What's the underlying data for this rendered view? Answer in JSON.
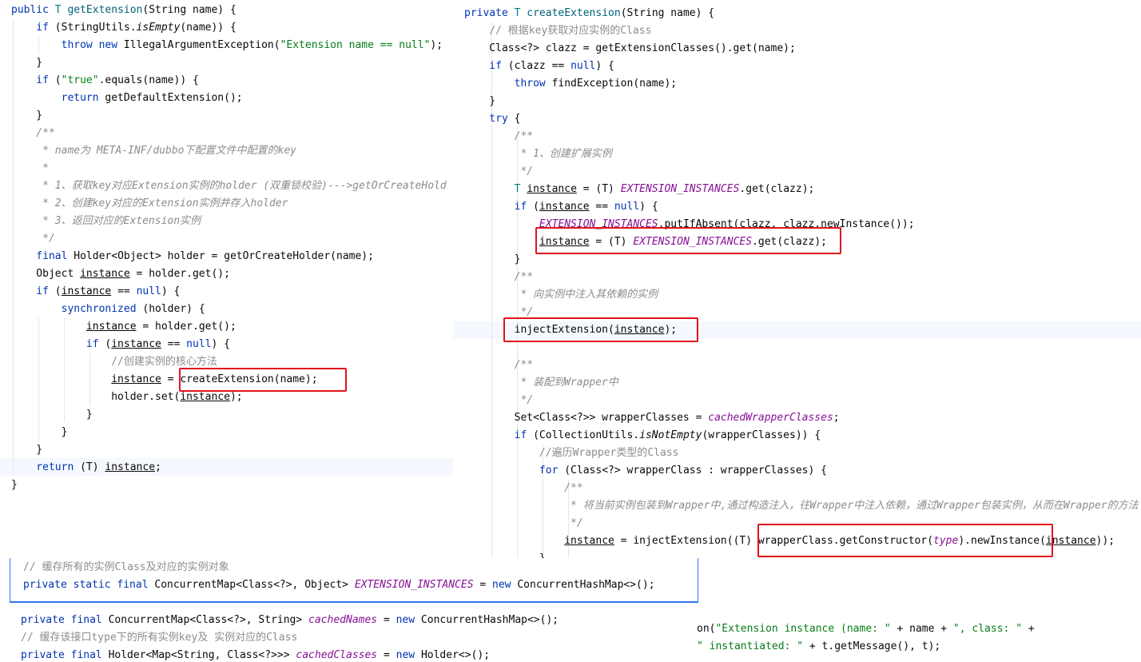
{
  "colors": {
    "keyword": "#0033b3",
    "string": "#067d17",
    "comment": "#8c8c8c",
    "field": "#871094",
    "method": "#00627a",
    "highlight_box": "#e0141b",
    "selection_border": "#3574f0"
  },
  "left": {
    "lines": [
      [
        [
          "public ",
          "kw"
        ],
        [
          "T ",
          "tp"
        ],
        [
          "getExtension",
          "fn"
        ],
        [
          "(String name) {",
          ""
        ]
      ],
      [
        [
          "    if ",
          "kw"
        ],
        [
          "(StringUtils.",
          ""
        ],
        [
          "isEmpty",
          "ital"
        ],
        [
          "(name)) {",
          ""
        ]
      ],
      [
        [
          "        throw new ",
          "kw"
        ],
        [
          "IllegalArgumentException(",
          ""
        ],
        [
          "\"Extension name == null\"",
          "str"
        ],
        [
          ");",
          ""
        ]
      ],
      [
        [
          "    }",
          ""
        ]
      ],
      [
        [
          "    if ",
          "kw"
        ],
        [
          "(",
          ""
        ],
        [
          "\"true\"",
          "str"
        ],
        [
          ".equals(name)) {",
          ""
        ]
      ],
      [
        [
          "        return ",
          "kw"
        ],
        [
          "getDefaultExtension();",
          ""
        ]
      ],
      [
        [
          "    }",
          ""
        ]
      ],
      [
        [
          "    /**",
          "doc"
        ]
      ],
      [
        [
          "     * name为 META-INF/dubbo下配置文件中配置的key",
          "doc"
        ]
      ],
      [
        [
          "     *",
          "doc"
        ]
      ],
      [
        [
          "     * 1、获取key对应Extension实例的holder (双重锁校验)--->getOrCreateHold",
          "doc"
        ]
      ],
      [
        [
          "     * 2、创建key对应的Extension实例并存入holder",
          "doc"
        ]
      ],
      [
        [
          "     * 3、返回对应的Extension实例",
          "doc"
        ]
      ],
      [
        [
          "     */",
          "doc"
        ]
      ],
      [
        [
          "    final ",
          "kw"
        ],
        [
          "Holder<Object> holder = getOrCreateHolder(name);",
          ""
        ]
      ],
      [
        [
          "    Object ",
          ""
        ],
        [
          "instance",
          "u"
        ],
        [
          " = holder.get();",
          ""
        ]
      ],
      [
        [
          "    if ",
          "kw"
        ],
        [
          "(",
          ""
        ],
        [
          "instance",
          "u"
        ],
        [
          " == ",
          ""
        ],
        [
          "null",
          "kw"
        ],
        [
          ") {",
          ""
        ]
      ],
      [
        [
          "        synchronized ",
          "kw"
        ],
        [
          "(holder) {",
          ""
        ]
      ],
      [
        [
          "            ",
          ""
        ],
        [
          "instance",
          "u"
        ],
        [
          " = holder.get();",
          ""
        ]
      ],
      [
        [
          "            if ",
          "kw"
        ],
        [
          "(",
          ""
        ],
        [
          "instance",
          "u"
        ],
        [
          " == ",
          ""
        ],
        [
          "null",
          "kw"
        ],
        [
          ") {",
          ""
        ]
      ],
      [
        [
          "                //创建实例的核心方法",
          "cmt"
        ]
      ],
      [
        [
          "                ",
          ""
        ],
        [
          "instance",
          "u"
        ],
        [
          " = createExtension(name);",
          ""
        ]
      ],
      [
        [
          "                holder.set(",
          ""
        ],
        [
          "instance",
          "u"
        ],
        [
          ");",
          ""
        ]
      ],
      [
        [
          "            }",
          ""
        ]
      ],
      [
        [
          "        }",
          ""
        ]
      ],
      [
        [
          "    }",
          ""
        ]
      ],
      [
        [
          "    return ",
          "kw"
        ],
        [
          "(T) ",
          ""
        ],
        [
          "instance",
          "u"
        ],
        [
          ";",
          ""
        ]
      ],
      [
        [
          "}",
          ""
        ]
      ]
    ]
  },
  "right": {
    "lines": [
      [
        [
          "private ",
          "kw"
        ],
        [
          "T ",
          "tp"
        ],
        [
          "createExtension",
          "fn"
        ],
        [
          "(String name) {",
          ""
        ]
      ],
      [
        [
          "    // 根据key获取对应实例的Class",
          "cmt"
        ]
      ],
      [
        [
          "    Class<?> clazz = getExtensionClasses().get(name);",
          ""
        ]
      ],
      [
        [
          "    if ",
          "kw"
        ],
        [
          "(clazz == ",
          ""
        ],
        [
          "null",
          "kw"
        ],
        [
          ") {",
          ""
        ]
      ],
      [
        [
          "        throw ",
          "kw"
        ],
        [
          "findException(name);",
          ""
        ]
      ],
      [
        [
          "    }",
          ""
        ]
      ],
      [
        [
          "    try ",
          "kw"
        ],
        [
          "{",
          ""
        ]
      ],
      [
        [
          "        /**",
          "doc"
        ]
      ],
      [
        [
          "         * 1、创建扩展实例",
          "doc"
        ]
      ],
      [
        [
          "         */",
          "doc"
        ]
      ],
      [
        [
          "        ",
          ""
        ],
        [
          "T ",
          "tp"
        ],
        [
          "instance",
          "u"
        ],
        [
          " = (T) ",
          ""
        ],
        [
          "EXTENSION_INSTANCES",
          "fld"
        ],
        [
          ".get(clazz);",
          ""
        ]
      ],
      [
        [
          "        if ",
          "kw"
        ],
        [
          "(",
          ""
        ],
        [
          "instance",
          "u"
        ],
        [
          " == ",
          ""
        ],
        [
          "null",
          "kw"
        ],
        [
          ") {",
          ""
        ]
      ],
      [
        [
          "            ",
          ""
        ],
        [
          "EXTENSION_INSTANCES",
          "fld"
        ],
        [
          ".putIfAbsent(clazz, clazz.newInstance());",
          ""
        ]
      ],
      [
        [
          "            ",
          ""
        ],
        [
          "instance",
          "u"
        ],
        [
          " = (T) ",
          ""
        ],
        [
          "EXTENSION_INSTANCES",
          "fld"
        ],
        [
          ".get(clazz);",
          ""
        ]
      ],
      [
        [
          "        }",
          ""
        ]
      ],
      [
        [
          "        /**",
          "doc"
        ]
      ],
      [
        [
          "         * 向实例中注入其依赖的实例",
          "doc"
        ]
      ],
      [
        [
          "         */",
          "doc"
        ]
      ],
      [
        [
          "        injectExtension(",
          ""
        ],
        [
          "instance",
          "u"
        ],
        [
          ");",
          ""
        ]
      ],
      [
        [
          "",
          ""
        ]
      ],
      [
        [
          "        /**",
          "doc"
        ]
      ],
      [
        [
          "         * 装配到Wrapper中",
          "doc"
        ]
      ],
      [
        [
          "         */",
          "doc"
        ]
      ],
      [
        [
          "        Set<Class<?>> wrapperClasses = ",
          ""
        ],
        [
          "cachedWrapperClasses",
          "fld"
        ],
        [
          ";",
          ""
        ]
      ],
      [
        [
          "        if ",
          "kw"
        ],
        [
          "(CollectionUtils.",
          ""
        ],
        [
          "isNotEmpty",
          "ital"
        ],
        [
          "(wrapperClasses)) {",
          ""
        ]
      ],
      [
        [
          "            //遍历Wrapper类型的Class",
          "cmt"
        ]
      ],
      [
        [
          "            for ",
          "kw"
        ],
        [
          "(Class<?> wrapperClass : wrapperClasses) {",
          ""
        ]
      ],
      [
        [
          "                /**",
          "doc"
        ]
      ],
      [
        [
          "                 * 将当前实例包装到Wrapper中,通过构造注入，往Wrapper中注入依赖，通过Wrapper包装实例，从而在Wrapper的方法",
          "doc"
        ]
      ],
      [
        [
          "                 */",
          "doc"
        ]
      ],
      [
        [
          "                ",
          ""
        ],
        [
          "instance",
          "u"
        ],
        [
          " = injectExtension((T) wrapperClass.getConstructor(",
          ""
        ],
        [
          "type",
          "fld"
        ],
        [
          ").newInstance(",
          ""
        ],
        [
          "instance",
          "u"
        ],
        [
          "));",
          ""
        ]
      ],
      [
        [
          "            }",
          ""
        ]
      ]
    ]
  },
  "fields_popup": {
    "lines": [
      [
        [
          "// 缓存所有的实例Class及对应的实例对象",
          "cmt"
        ]
      ],
      [
        [
          "private static final ",
          "kw"
        ],
        [
          "ConcurrentMap<Class<?>, Object> ",
          ""
        ],
        [
          "EXTENSION_INSTANCES",
          "fld"
        ],
        [
          " = ",
          ""
        ],
        [
          "new ",
          "kw"
        ],
        [
          "ConcurrentHashMap<>();",
          ""
        ]
      ]
    ]
  },
  "fields_bottom": {
    "lines": [
      [
        [
          "private final ",
          "kw"
        ],
        [
          "ConcurrentMap<Class<?>, String> ",
          ""
        ],
        [
          "cachedNames",
          "fld"
        ],
        [
          " = ",
          ""
        ],
        [
          "new ",
          "kw"
        ],
        [
          "ConcurrentHashMap<>();",
          ""
        ]
      ],
      [
        [
          "// 缓存该接口type下的所有实例key及 实例对应的Class",
          "cmt"
        ]
      ],
      [
        [
          "private final ",
          "kw"
        ],
        [
          "Holder<Map<String, Class<?>>> ",
          ""
        ],
        [
          "cachedClasses",
          "fld"
        ],
        [
          " = ",
          ""
        ],
        [
          "new ",
          "kw"
        ],
        [
          "Holder<>();",
          ""
        ]
      ]
    ]
  },
  "fragment": {
    "lines": [
      [
        [
          "on(",
          ""
        ],
        [
          "\"Extension instance (name: \"",
          "str"
        ],
        [
          " + name + ",
          ""
        ],
        [
          "\", class: \"",
          "str"
        ],
        [
          " +",
          ""
        ]
      ],
      [
        [
          "",
          ""
        ],
        [
          "\" instantiated: \"",
          "str"
        ],
        [
          " + t.getMessage(), t);",
          ""
        ]
      ]
    ]
  }
}
